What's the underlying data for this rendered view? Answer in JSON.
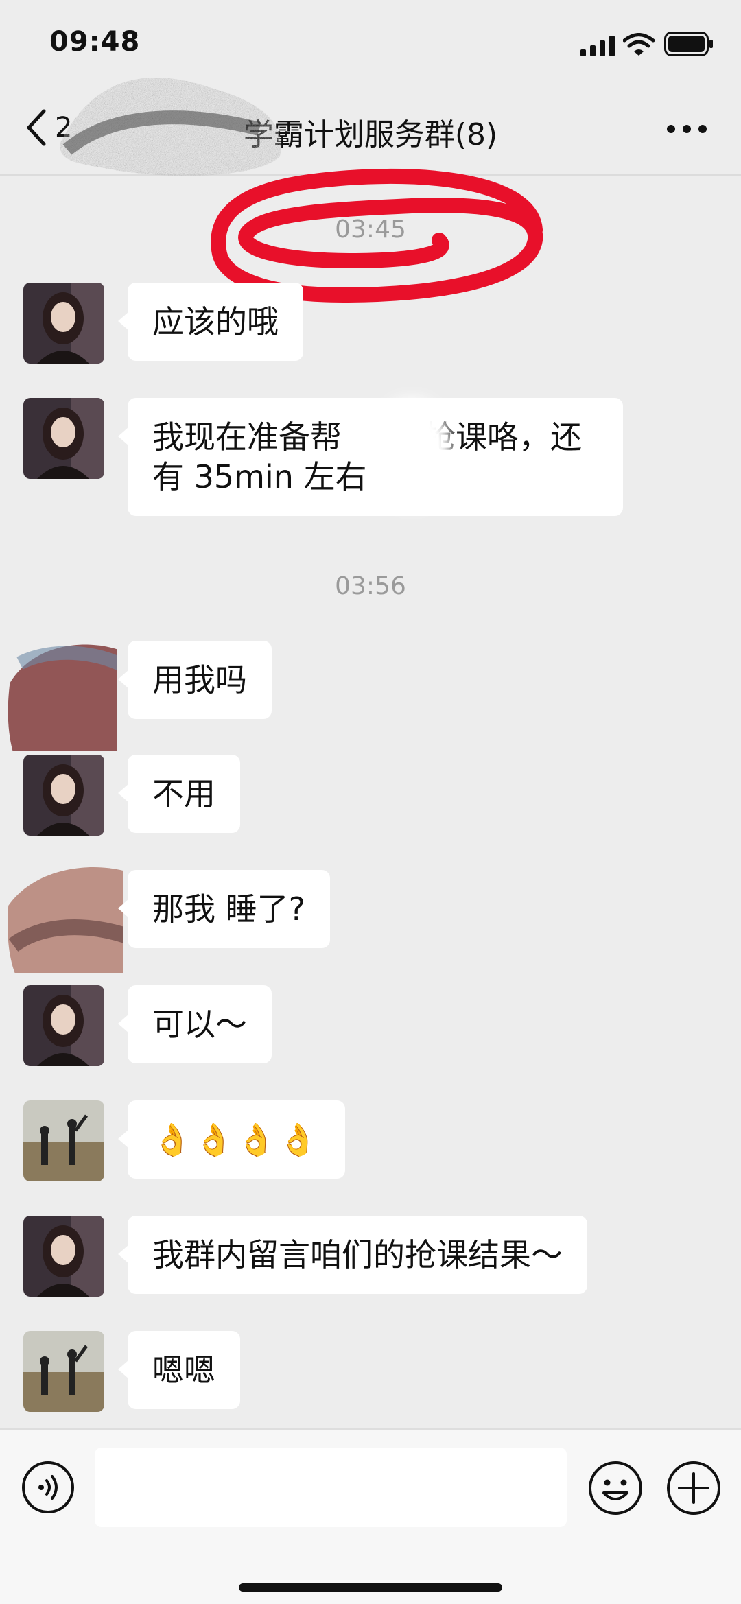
{
  "status_bar": {
    "time": "09:48",
    "icons": [
      "signal-icon",
      "wifi-icon",
      "battery-icon"
    ]
  },
  "nav": {
    "back_count": "2",
    "title": "学霸计划服务群(8)",
    "more_icon": "more-icon"
  },
  "messages": {
    "time_1": "03:45",
    "time_2": "03:56",
    "m1": "应该的哦",
    "m2_line1": "我现在准备帮",
    "m2_line1b": "抢课咯，还",
    "m2_line2": "有 35min 左右",
    "m3": "用我吗",
    "m4": "不用",
    "m5": "那我 睡了?",
    "m6": "可以～",
    "m7": "👌👌👌👌",
    "m8": "我群内留言咱们的抢课结果～",
    "m9": "嗯嗯"
  },
  "input_bar": {
    "icons": [
      "voice-icon",
      "emoji-icon",
      "plus-icon"
    ]
  },
  "colors": {
    "background": "#ededed",
    "bubble": "#ffffff",
    "timestamp": "#9a9a9a",
    "red_mark": "#e8102a"
  }
}
